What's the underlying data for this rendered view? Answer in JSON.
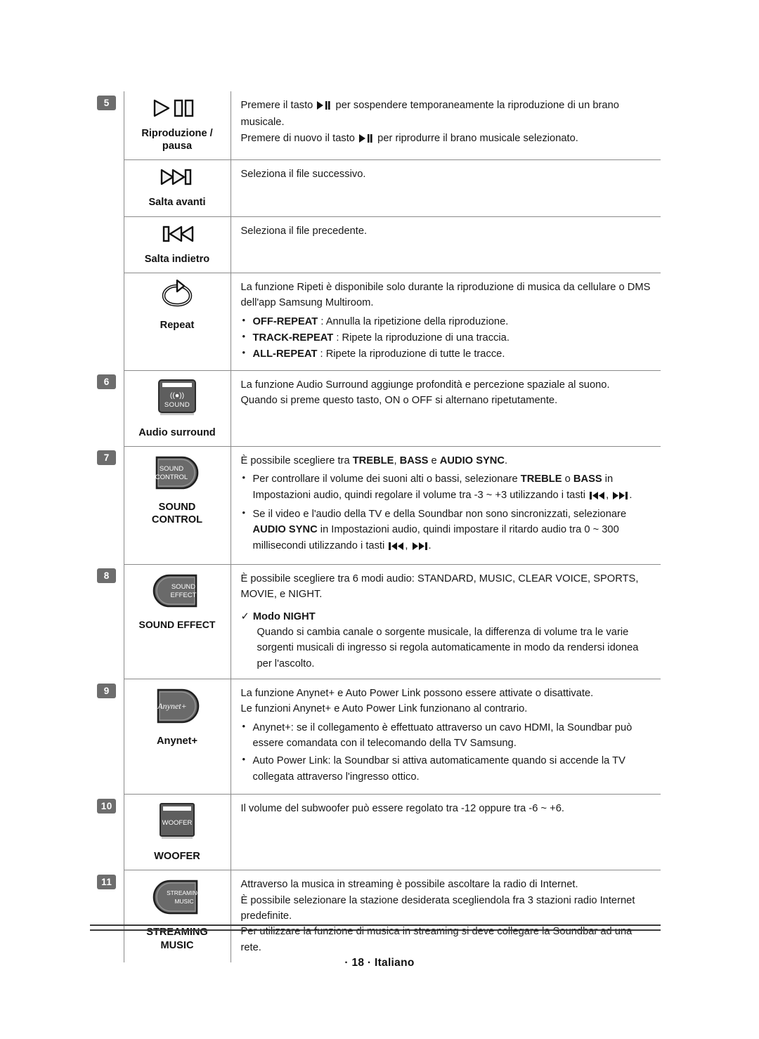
{
  "document": {
    "footer": "· 18 · Italiano",
    "language": "Italiano",
    "page_number": "18"
  },
  "table": {
    "rows": [
      {
        "number": "5",
        "icon": "play-pause-icon",
        "caption": "Riproduzione /\npausa",
        "lines": [
          "Premere il tasto ▶❚❚ per sospendere temporaneamente la riproduzione di un brano musicale.",
          "Premere di nuovo il tasto ▶❚❚ per riprodurre il brano musicale selezionato."
        ],
        "line1a": "Premere il tasto",
        "line1b": "per sospendere temporaneamente la riproduzione di un brano",
        "line1c": "musicale.",
        "line2a": "Premere di nuovo il tasto",
        "line2b": "per riprodurre il brano musicale selezionato."
      },
      {
        "number": "",
        "icon": "skip-forward-icon",
        "caption": "Salta avanti",
        "text": "Seleziona il file successivo."
      },
      {
        "number": "",
        "icon": "skip-backward-icon",
        "caption": "Salta indietro",
        "text": "Seleziona il file precedente."
      },
      {
        "number": "",
        "icon": "repeat-icon",
        "caption": "Repeat",
        "intro": "La funzione Ripeti è disponibile solo durante la riproduzione di musica da cellulare o DMS dell'app Samsung Multiroom.",
        "bullets": [
          {
            "label": "OFF-REPEAT",
            "sep": " : ",
            "text": "Annulla la ripetizione della riproduzione."
          },
          {
            "label": "TRACK-REPEAT",
            "sep": " : ",
            "text": "Ripete la riproduzione di una traccia."
          },
          {
            "label": "ALL-REPEAT",
            "sep": " : ",
            "text": " Ripete la riproduzione di tutte le tracce."
          }
        ]
      },
      {
        "number": "6",
        "icon": "audio-surround-button-icon",
        "button_text_top": "((●))",
        "button_text_bottom": "SOUND",
        "caption": "Audio surround",
        "intro": "La funzione Audio Surround aggiunge profondità e percezione spaziale al suono. Quando si preme questo tasto, ON o OFF si alternano ripetutamente.",
        "line1": "La funzione Audio Surround aggiunge profondità e percezione spaziale al suono.",
        "line2": "Quando si preme questo tasto, ON o OFF si alternano ripetutamente."
      },
      {
        "number": "7",
        "icon": "sound-control-button-icon",
        "button_text_top": "SOUND",
        "button_text_bottom": "CONTROL",
        "caption": "SOUND\nCONTROL",
        "intro_a": "È possibile scegliere tra ",
        "intro_b": "TREBLE",
        "intro_c": ", ",
        "intro_d": "BASS",
        "intro_e": " e ",
        "intro_f": "AUDIO SYNC",
        "intro_g": ".",
        "b1_a": "Per controllare il volume dei suoni alti o bassi, selezionare ",
        "b1_b": "TREBLE",
        "b1_c": " o ",
        "b1_d": "BASS",
        "b1_e": " in Impostazioni audio, quindi regolare il volume tra -3 ~ +3 utilizzando i tasti",
        "b1_f": ",",
        "b1_g": ".",
        "b2_a": "Se il video e l'audio della TV e della Soundbar non sono sincronizzati, selezionare ",
        "b2_b": "AUDIO SYNC",
        "b2_c": " in Impostazioni audio, quindi impostare il ritardo audio tra 0 ~ 300 millisecondi utilizzando i tasti",
        "b2_d": ",",
        "b2_e": "."
      },
      {
        "number": "8",
        "icon": "sound-effect-button-icon",
        "button_text_top": "SOUND",
        "button_text_bottom": "EFFECT",
        "caption": "SOUND EFFECT",
        "line1": "È possibile scegliere tra 6 modi audio: STANDARD, MUSIC, CLEAR VOICE, SPORTS,",
        "line2": "MOVIE, e NIGHT.",
        "check_label": "Modo NIGHT",
        "check_tick": "✓",
        "check_body": "Quando si cambia canale o sorgente musicale, la differenza di volume tra le varie sorgenti musicali di ingresso si regola automaticamente in modo da rendersi idonea per l'ascolto."
      },
      {
        "number": "9",
        "icon": "anynet-button-icon",
        "button_text": "Anynet+",
        "caption": "Anynet+",
        "line1": "La funzione  Anynet+ e Auto Power Link possono essere attivate o disattivate.",
        "line2": "Le funzioni Anynet+ e Auto Power Link funzionano al contrario.",
        "bullets": [
          "Anynet+: se il collegamento è effettuato attraverso un cavo HDMI, la Soundbar può essere comandata con il telecomando della TV Samsung.",
          "Auto Power Link: la Soundbar si attiva automaticamente quando si accende la TV collegata attraverso l'ingresso ottico."
        ]
      },
      {
        "number": "10",
        "icon": "woofer-button-icon",
        "button_text": "WOOFER",
        "caption": "WOOFER",
        "text": "Il volume del subwoofer può essere regolato tra -12 oppure tra -6 ~ +6."
      },
      {
        "number": "11",
        "icon": "streaming-music-button-icon",
        "button_text_top": "STREAMING",
        "button_text_bottom": "MUSIC",
        "caption": "STREAMING\nMUSIC",
        "line1": "Attraverso la musica in streaming è possibile ascoltare la radio di Internet.",
        "line2": "È possibile selezionare la stazione desiderata scegliendola fra 3 stazioni radio Internet predefinite.",
        "line3": "Per utilizzare la funzione di musica in streaming si deve collegare la Soundbar ad una rete."
      }
    ]
  },
  "colors": {
    "badge_bg": "#6d6d6d",
    "rule": "#8a8a8a",
    "button_dark": "#5a5a5a",
    "text": "#171717"
  }
}
